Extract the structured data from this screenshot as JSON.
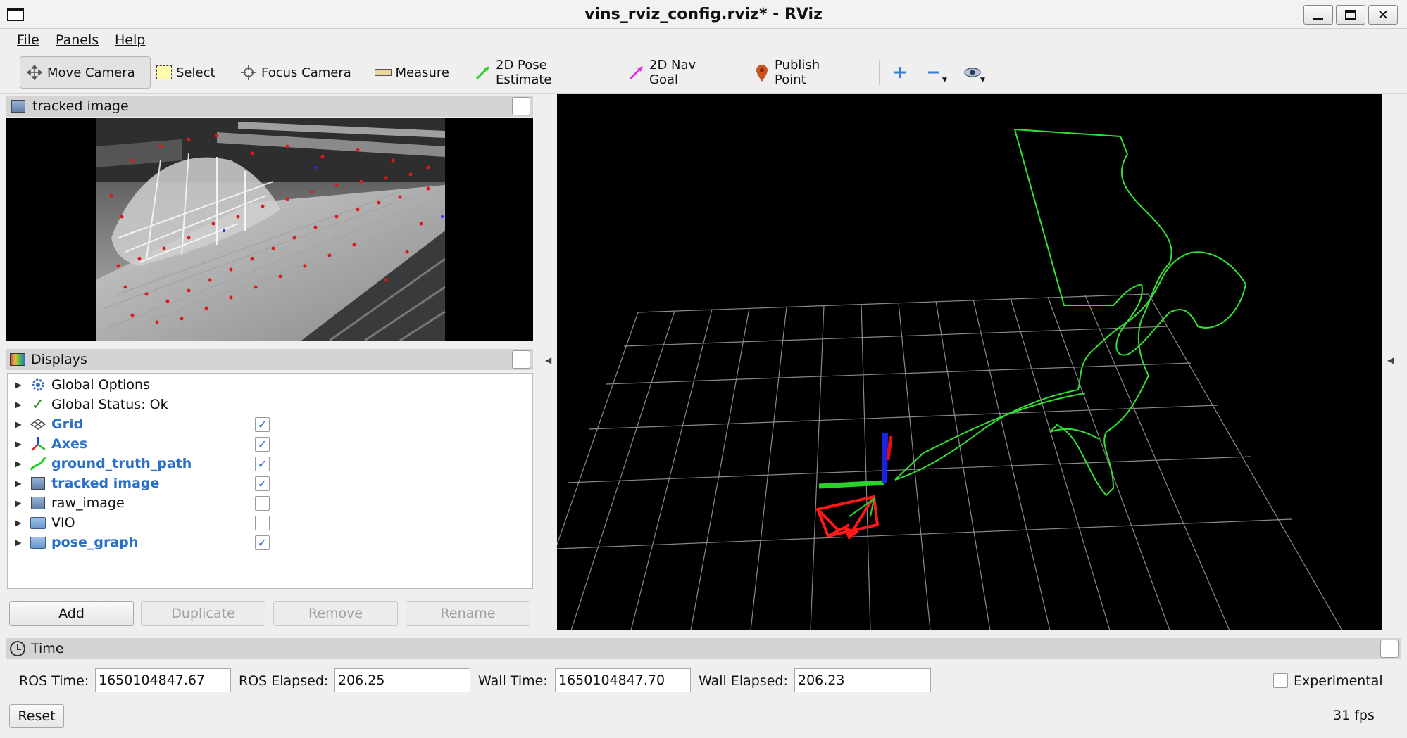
{
  "window": {
    "title": "vins_rviz_config.rviz* - RViz"
  },
  "menu": [
    "File",
    "Panels",
    "Help"
  ],
  "toolbar": {
    "tools": [
      {
        "label": "Move Camera",
        "icon": "move-camera-icon",
        "active": true
      },
      {
        "label": "Select",
        "icon": "select-icon"
      },
      {
        "label": "Focus Camera",
        "icon": "focus-camera-icon"
      },
      {
        "label": "Measure",
        "icon": "measure-icon"
      },
      {
        "label": "2D Pose Estimate",
        "icon": "pose-estimate-icon",
        "color": "#2fcf2f"
      },
      {
        "label": "2D Nav Goal",
        "icon": "nav-goal-icon",
        "color": "#e030e0"
      },
      {
        "label": "Publish Point",
        "icon": "publish-point-icon",
        "color": "#d2541e"
      }
    ],
    "extra_icons": [
      "add-tool-icon",
      "remove-tool-icon",
      "view-icon"
    ]
  },
  "image_panel": {
    "title": "tracked image"
  },
  "displays_panel": {
    "title": "Displays",
    "items": [
      {
        "label": "Global Options",
        "icon": "gear-icon",
        "bold": false,
        "checkbox": null
      },
      {
        "label": "Global Status: Ok",
        "icon": "checkmark-icon",
        "bold": false,
        "checkbox": null
      },
      {
        "label": "Grid",
        "icon": "grid-icon",
        "bold": true,
        "checkbox": true
      },
      {
        "label": "Axes",
        "icon": "axes-icon",
        "bold": true,
        "checkbox": true
      },
      {
        "label": "ground_truth_path",
        "icon": "path-icon",
        "bold": true,
        "checkbox": true
      },
      {
        "label": "tracked image",
        "icon": "image-icon",
        "bold": true,
        "checkbox": true
      },
      {
        "label": "raw_image",
        "icon": "image-icon",
        "bold": false,
        "checkbox": false
      },
      {
        "label": "VIO",
        "icon": "folder-icon",
        "bold": false,
        "checkbox": false
      },
      {
        "label": "pose_graph",
        "icon": "folder-icon",
        "bold": true,
        "checkbox": true
      }
    ],
    "buttons": [
      {
        "label": "Add",
        "enabled": true
      },
      {
        "label": "Duplicate",
        "enabled": false
      },
      {
        "label": "Remove",
        "enabled": false
      },
      {
        "label": "Rename",
        "enabled": false
      }
    ]
  },
  "time_panel": {
    "title": "Time",
    "ros_time_label": "ROS Time:",
    "ros_time": "1650104847.67",
    "ros_elapsed_label": "ROS Elapsed:",
    "ros_elapsed": "206.25",
    "wall_time_label": "Wall Time:",
    "wall_time": "1650104847.70",
    "wall_elapsed_label": "Wall Elapsed:",
    "wall_elapsed": "206.23",
    "experimental_label": "Experimental",
    "reset_label": "Reset",
    "fps": "31 fps"
  },
  "colors": {
    "accent": "#2a6fc9",
    "path": "#3ddc3d",
    "frustum": "#ff2020",
    "axis_x": "#e01010",
    "axis_y": "#20d020",
    "axis_z": "#1020e0"
  }
}
